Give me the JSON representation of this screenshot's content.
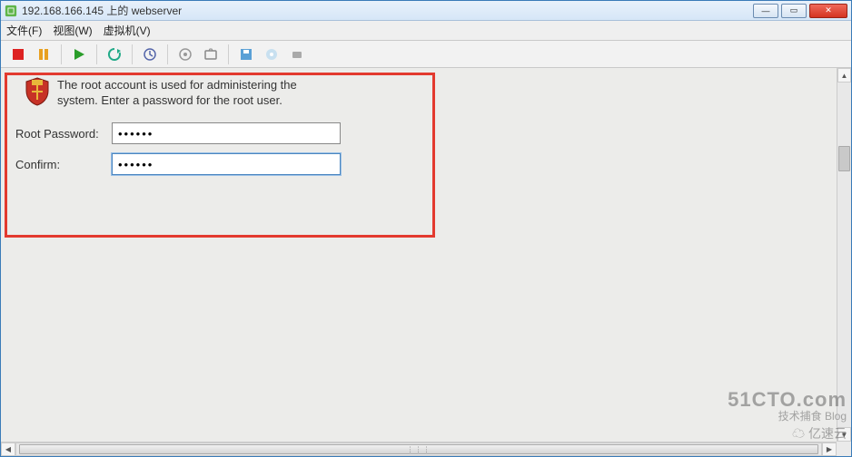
{
  "window": {
    "title": "192.168.166.145 上的 webserver"
  },
  "menubar": {
    "file": "文件(F)",
    "view": "视图(W)",
    "vm": "虚拟机(V)"
  },
  "toolbar_icons": {
    "stop": "stop",
    "pause": "pause",
    "play": "play",
    "refresh": "refresh",
    "snapshot": "snapshot",
    "camera": "camera",
    "capture": "capture",
    "disk": "disk",
    "cd": "cd",
    "usb": "usb"
  },
  "installer": {
    "description": "The root account is used for administering the system.  Enter a password for the root user.",
    "root_password_label": "Root Password:",
    "confirm_label": "Confirm:",
    "root_password_value": "••••••",
    "confirm_value": "••••••"
  },
  "watermark": {
    "line1": "51CTO.com",
    "line2": "技术捕食   Blog",
    "line3": "亿速云"
  }
}
